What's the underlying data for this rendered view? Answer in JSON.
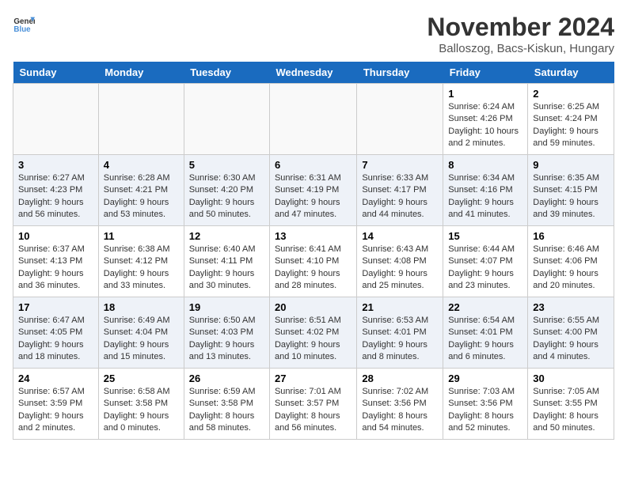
{
  "header": {
    "logo_line1": "General",
    "logo_line2": "Blue",
    "month_title": "November 2024",
    "location": "Balloszog, Bacs-Kiskun, Hungary"
  },
  "days_of_week": [
    "Sunday",
    "Monday",
    "Tuesday",
    "Wednesday",
    "Thursday",
    "Friday",
    "Saturday"
  ],
  "weeks": [
    {
      "days": [
        {
          "num": "",
          "info": ""
        },
        {
          "num": "",
          "info": ""
        },
        {
          "num": "",
          "info": ""
        },
        {
          "num": "",
          "info": ""
        },
        {
          "num": "",
          "info": ""
        },
        {
          "num": "1",
          "info": "Sunrise: 6:24 AM\nSunset: 4:26 PM\nDaylight: 10 hours\nand 2 minutes."
        },
        {
          "num": "2",
          "info": "Sunrise: 6:25 AM\nSunset: 4:24 PM\nDaylight: 9 hours\nand 59 minutes."
        }
      ]
    },
    {
      "days": [
        {
          "num": "3",
          "info": "Sunrise: 6:27 AM\nSunset: 4:23 PM\nDaylight: 9 hours\nand 56 minutes."
        },
        {
          "num": "4",
          "info": "Sunrise: 6:28 AM\nSunset: 4:21 PM\nDaylight: 9 hours\nand 53 minutes."
        },
        {
          "num": "5",
          "info": "Sunrise: 6:30 AM\nSunset: 4:20 PM\nDaylight: 9 hours\nand 50 minutes."
        },
        {
          "num": "6",
          "info": "Sunrise: 6:31 AM\nSunset: 4:19 PM\nDaylight: 9 hours\nand 47 minutes."
        },
        {
          "num": "7",
          "info": "Sunrise: 6:33 AM\nSunset: 4:17 PM\nDaylight: 9 hours\nand 44 minutes."
        },
        {
          "num": "8",
          "info": "Sunrise: 6:34 AM\nSunset: 4:16 PM\nDaylight: 9 hours\nand 41 minutes."
        },
        {
          "num": "9",
          "info": "Sunrise: 6:35 AM\nSunset: 4:15 PM\nDaylight: 9 hours\nand 39 minutes."
        }
      ]
    },
    {
      "days": [
        {
          "num": "10",
          "info": "Sunrise: 6:37 AM\nSunset: 4:13 PM\nDaylight: 9 hours\nand 36 minutes."
        },
        {
          "num": "11",
          "info": "Sunrise: 6:38 AM\nSunset: 4:12 PM\nDaylight: 9 hours\nand 33 minutes."
        },
        {
          "num": "12",
          "info": "Sunrise: 6:40 AM\nSunset: 4:11 PM\nDaylight: 9 hours\nand 30 minutes."
        },
        {
          "num": "13",
          "info": "Sunrise: 6:41 AM\nSunset: 4:10 PM\nDaylight: 9 hours\nand 28 minutes."
        },
        {
          "num": "14",
          "info": "Sunrise: 6:43 AM\nSunset: 4:08 PM\nDaylight: 9 hours\nand 25 minutes."
        },
        {
          "num": "15",
          "info": "Sunrise: 6:44 AM\nSunset: 4:07 PM\nDaylight: 9 hours\nand 23 minutes."
        },
        {
          "num": "16",
          "info": "Sunrise: 6:46 AM\nSunset: 4:06 PM\nDaylight: 9 hours\nand 20 minutes."
        }
      ]
    },
    {
      "days": [
        {
          "num": "17",
          "info": "Sunrise: 6:47 AM\nSunset: 4:05 PM\nDaylight: 9 hours\nand 18 minutes."
        },
        {
          "num": "18",
          "info": "Sunrise: 6:49 AM\nSunset: 4:04 PM\nDaylight: 9 hours\nand 15 minutes."
        },
        {
          "num": "19",
          "info": "Sunrise: 6:50 AM\nSunset: 4:03 PM\nDaylight: 9 hours\nand 13 minutes."
        },
        {
          "num": "20",
          "info": "Sunrise: 6:51 AM\nSunset: 4:02 PM\nDaylight: 9 hours\nand 10 minutes."
        },
        {
          "num": "21",
          "info": "Sunrise: 6:53 AM\nSunset: 4:01 PM\nDaylight: 9 hours\nand 8 minutes."
        },
        {
          "num": "22",
          "info": "Sunrise: 6:54 AM\nSunset: 4:01 PM\nDaylight: 9 hours\nand 6 minutes."
        },
        {
          "num": "23",
          "info": "Sunrise: 6:55 AM\nSunset: 4:00 PM\nDaylight: 9 hours\nand 4 minutes."
        }
      ]
    },
    {
      "days": [
        {
          "num": "24",
          "info": "Sunrise: 6:57 AM\nSunset: 3:59 PM\nDaylight: 9 hours\nand 2 minutes."
        },
        {
          "num": "25",
          "info": "Sunrise: 6:58 AM\nSunset: 3:58 PM\nDaylight: 9 hours\nand 0 minutes."
        },
        {
          "num": "26",
          "info": "Sunrise: 6:59 AM\nSunset: 3:58 PM\nDaylight: 8 hours\nand 58 minutes."
        },
        {
          "num": "27",
          "info": "Sunrise: 7:01 AM\nSunset: 3:57 PM\nDaylight: 8 hours\nand 56 minutes."
        },
        {
          "num": "28",
          "info": "Sunrise: 7:02 AM\nSunset: 3:56 PM\nDaylight: 8 hours\nand 54 minutes."
        },
        {
          "num": "29",
          "info": "Sunrise: 7:03 AM\nSunset: 3:56 PM\nDaylight: 8 hours\nand 52 minutes."
        },
        {
          "num": "30",
          "info": "Sunrise: 7:05 AM\nSunset: 3:55 PM\nDaylight: 8 hours\nand 50 minutes."
        }
      ]
    }
  ]
}
